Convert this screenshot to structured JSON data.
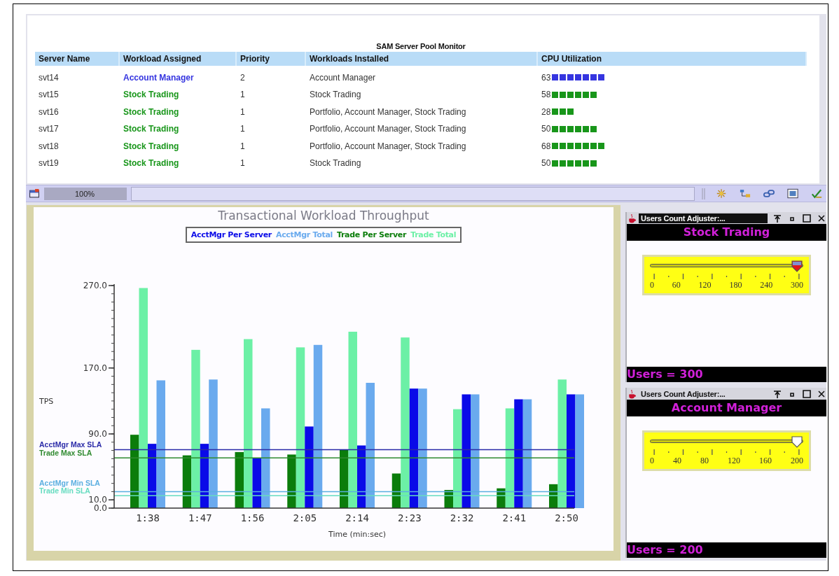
{
  "app": {
    "title": "SAM Server Pool Monitor"
  },
  "table": {
    "columns": [
      "Server Name",
      "Workload Assigned",
      "Priority",
      "Workloads Installed",
      "CPU Utilization"
    ],
    "rows": [
      {
        "server": "svt14",
        "assigned": "Account Manager",
        "priority": "2",
        "installed": "Account Manager",
        "cpu": "63",
        "color": "#3535e0"
      },
      {
        "server": "svt15",
        "assigned": "Stock Trading",
        "priority": "1",
        "installed": "Stock Trading",
        "cpu": "58",
        "color": "#18961a"
      },
      {
        "server": "svt16",
        "assigned": "Stock Trading",
        "priority": "1",
        "installed": "Portfolio, Account Manager, Stock Trading",
        "cpu": "28",
        "color": "#18961a"
      },
      {
        "server": "svt17",
        "assigned": "Stock Trading",
        "priority": "1",
        "installed": "Portfolio, Account Manager, Stock Trading",
        "cpu": "50",
        "color": "#18961a"
      },
      {
        "server": "svt18",
        "assigned": "Stock Trading",
        "priority": "1",
        "installed": "Portfolio, Account Manager, Stock Trading",
        "cpu": "68",
        "color": "#18961a"
      },
      {
        "server": "svt19",
        "assigned": "Stock Trading",
        "priority": "1",
        "installed": "Stock Trading",
        "cpu": "50",
        "color": "#18961a"
      }
    ]
  },
  "toolbar": {
    "zoom": "100%"
  },
  "chart": {
    "chart_data": {
      "type": "bar",
      "title": "Transactional Workload Throughput",
      "xlabel": "Time (min:sec)",
      "ylabel": "TPS",
      "categories": [
        "1:38",
        "1:47",
        "1:56",
        "2:05",
        "2:14",
        "2:23",
        "2:32",
        "2:41",
        "2:50"
      ],
      "series": [
        {
          "name": "AcctMgr Per Server",
          "color": "#0a0ae8",
          "values": [
            78,
            78,
            61,
            99,
            76,
            145,
            138,
            132,
            138
          ]
        },
        {
          "name": "AcctMgr Total",
          "color": "#6aaaee",
          "values": [
            155,
            156,
            121,
            198,
            152,
            145,
            138,
            132,
            138
          ]
        },
        {
          "name": "Trade Per Server",
          "color": "#0b7d0b",
          "values": [
            89,
            64,
            68,
            65,
            71,
            42,
            22,
            24,
            29
          ]
        },
        {
          "name": "Trade Total",
          "color": "#6cf0a6",
          "values": [
            267,
            192,
            205,
            195,
            214,
            207,
            120,
            121,
            156
          ]
        }
      ],
      "ylim": [
        0,
        270
      ],
      "yticks": [
        {
          "value": 0,
          "label": "0.0"
        },
        {
          "value": 10,
          "label": "10.0"
        },
        {
          "value": 90,
          "label": "90.0"
        },
        {
          "value": 170,
          "label": "170.0"
        },
        {
          "value": 270,
          "label": "270.0"
        }
      ],
      "ref_lines": [
        {
          "axis": "y",
          "value": 71,
          "label": "AcctMgr Max SLA",
          "color": "#2a2aa8"
        },
        {
          "axis": "y",
          "value": 61,
          "label": "Trade Max SLA",
          "color": "#2f8a2f"
        },
        {
          "axis": "y",
          "value": 20,
          "label": "AcctMgr Min SLA",
          "color": "#5aaee0"
        },
        {
          "axis": "y",
          "value": 15,
          "label": "Trade Min SLA",
          "color": "#66dcc0"
        }
      ]
    }
  },
  "adjusters": [
    {
      "title": "Users Count Adjuster:...",
      "active": true,
      "heading": "Stock Trading",
      "ticks": [
        "0",
        "60",
        "120",
        "180",
        "240",
        "300"
      ],
      "level": 1,
      "readout": "Users = 300"
    },
    {
      "title": "Users Count Adjuster:...",
      "active": false,
      "heading": "Account Manager",
      "ticks": [
        "0",
        "40",
        "80",
        "120",
        "160",
        "200"
      ],
      "level": 1,
      "readout": "Users = 200"
    }
  ]
}
